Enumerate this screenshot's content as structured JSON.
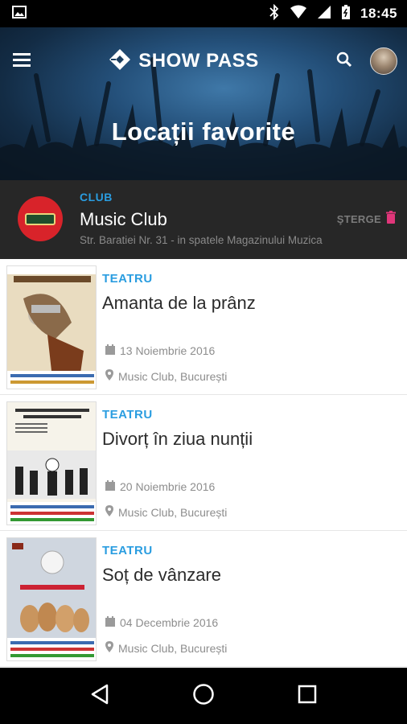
{
  "status": {
    "time": "18:45"
  },
  "header": {
    "brand": "SHOW PASS",
    "title": "Locații favorite"
  },
  "venue": {
    "category": "CLUB",
    "name": "Music Club",
    "address": "Str. Baratiei Nr. 31 - in spatele Magazinului Muzica",
    "delete_label": "ŞTERGE"
  },
  "events": [
    {
      "category": "TEATRU",
      "title": "Amanta de la prânz",
      "date": "13 Noiembrie 2016",
      "location": "Music Club, București"
    },
    {
      "category": "TEATRU",
      "title": "Divorț în ziua nunții",
      "date": "20 Noiembrie 2016",
      "location": "Music Club, București"
    },
    {
      "category": "TEATRU",
      "title": "Soț de vânzare",
      "date": "04 Decembrie 2016",
      "location": "Music Club, București"
    }
  ],
  "colors": {
    "accent": "#2a9de0",
    "delete": "#e0367a",
    "venue_bg": "#272727"
  }
}
